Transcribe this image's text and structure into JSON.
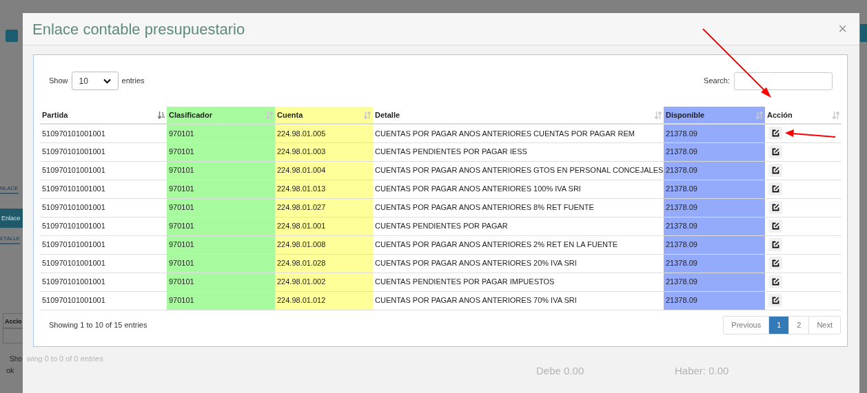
{
  "background_page": {
    "tab_fragment": "NLACE",
    "section_button": "Enlace",
    "detail_fragment": "ETALLE",
    "table_header": "Accio",
    "info_fragment": "Sho",
    "ok_text": "ok"
  },
  "modal": {
    "title": "Enlace contable presupuestario",
    "close": "×",
    "show_label": "Show",
    "page_length": "10",
    "entries_label": "entries",
    "search_label": "Search:",
    "columns": [
      {
        "label": "Partida",
        "sorted": true
      },
      {
        "label": "Clasificador",
        "sorted": false,
        "color": "#a8fa9f"
      },
      {
        "label": "Cuenta",
        "sorted": false,
        "color": "#ffff99"
      },
      {
        "label": "Detalle",
        "sorted": false
      },
      {
        "label": "Disponible",
        "sorted": false,
        "color": "#94aafb"
      },
      {
        "label": "Acción",
        "sorted": false
      }
    ],
    "rows": [
      {
        "partida": "510970101001001",
        "clasificador": "970101",
        "cuenta": "224.98.01.005",
        "detalle": "CUENTAS POR PAGAR ANOS ANTERIORES CUENTAS POR PAGAR REM",
        "disponible": "21378.09"
      },
      {
        "partida": "510970101001001",
        "clasificador": "970101",
        "cuenta": "224.98.01.003",
        "detalle": "CUENTAS PENDIENTES POR PAGAR IESS",
        "disponible": "21378.09"
      },
      {
        "partida": "510970101001001",
        "clasificador": "970101",
        "cuenta": "224.98.01.004",
        "detalle": "CUENTAS POR PAGAR ANOS ANTERIORES GTOS EN PERSONAL CONCEJALES",
        "disponible": "21378.09"
      },
      {
        "partida": "510970101001001",
        "clasificador": "970101",
        "cuenta": "224.98.01.013",
        "detalle": "CUENTAS POR PAGAR ANOS ANTERIORES 100% IVA SRI",
        "disponible": "21378.09"
      },
      {
        "partida": "510970101001001",
        "clasificador": "970101",
        "cuenta": "224.98.01.027",
        "detalle": "CUENTAS POR PAGAR ANOS ANTERIORES 8% RET FUENTE",
        "disponible": "21378.09"
      },
      {
        "partida": "510970101001001",
        "clasificador": "970101",
        "cuenta": "224.98.01.001",
        "detalle": "CUENTAS PENDIENTES POR PAGAR",
        "disponible": "21378.09"
      },
      {
        "partida": "510970101001001",
        "clasificador": "970101",
        "cuenta": "224.98.01.008",
        "detalle": "CUENTAS POR PAGAR ANOS ANTERIORES 2% RET EN LA FUENTE",
        "disponible": "21378.09"
      },
      {
        "partida": "510970101001001",
        "clasificador": "970101",
        "cuenta": "224.98.01.028",
        "detalle": "CUENTAS POR PAGAR ANOS ANTERIORES 20% IVA SRI",
        "disponible": "21378.09"
      },
      {
        "partida": "510970101001001",
        "clasificador": "970101",
        "cuenta": "224.98.01.002",
        "detalle": "CUENTAS PENDIENTES POR PAGAR IMPUESTOS",
        "disponible": "21378.09"
      },
      {
        "partida": "510970101001001",
        "clasificador": "970101",
        "cuenta": "224.98.01.012",
        "detalle": "CUENTAS POR PAGAR ANOS ANTERIORES 70% IVA SRI",
        "disponible": "21378.09"
      }
    ],
    "info": "Showing 1 to 10 of 15 entries",
    "pagination": [
      {
        "label": "Previous",
        "selected": false
      },
      {
        "label": "1",
        "selected": true
      },
      {
        "label": "2",
        "selected": false
      },
      {
        "label": "Next",
        "selected": false
      }
    ],
    "faint_texts": [
      "wing 0 to 0 of 0 entries",
      "Debe 0.00",
      "Haber: 0.00"
    ]
  }
}
